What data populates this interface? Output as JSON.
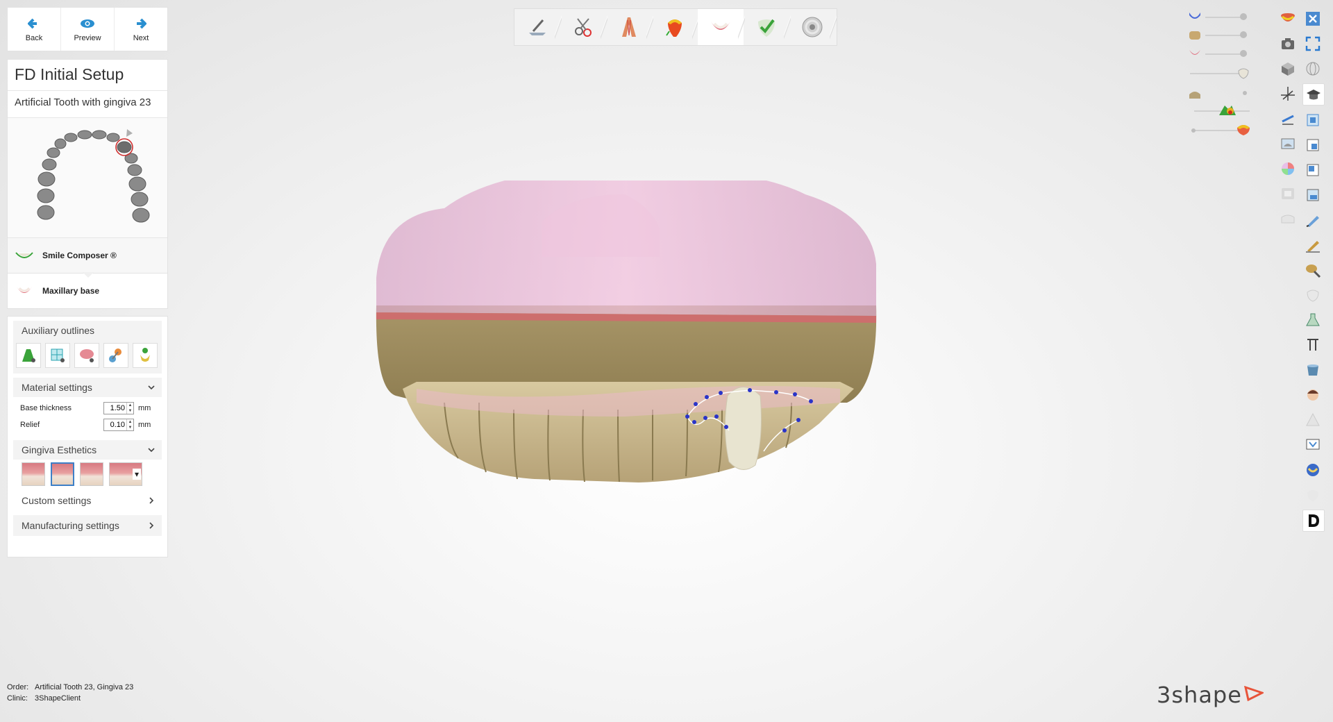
{
  "nav": {
    "back_label": "Back",
    "preview_label": "Preview",
    "next_label": "Next"
  },
  "setup": {
    "title": "FD Initial Setup",
    "subtitle": "Artificial Tooth with gingiva 23",
    "steps": [
      {
        "label": "Smile Composer ®",
        "icon": "smile-composer-icon"
      },
      {
        "label": "Maxillary base",
        "icon": "maxillary-base-icon"
      }
    ]
  },
  "panel": {
    "aux_title": "Auxiliary outlines",
    "aux_tools": [
      "gingiva-outline-icon",
      "grid-outline-icon",
      "palate-outline-icon",
      "clasp-outline-icon",
      "tooth-outline-icon"
    ],
    "material_title": "Material settings",
    "base_thickness_label": "Base thickness",
    "base_thickness_value": "1.50",
    "relief_label": "Relief",
    "relief_value": "0.10",
    "unit": "mm",
    "gingiva_title": "Gingiva Esthetics",
    "custom_settings": "Custom settings",
    "manufacturing_settings": "Manufacturing settings"
  },
  "toolbar": {
    "steps": [
      "scan-prep-icon",
      "model-tools-icon",
      "arch-icon",
      "tooth-color-icon",
      "gingiva-icon",
      "check-icon",
      "disc-icon"
    ],
    "active_index": 4
  },
  "sliders": [
    {
      "icon": "upper-jaw-icon",
      "level": 1.0
    },
    {
      "icon": "lower-jaw-icon",
      "level": 1.0
    },
    {
      "icon": "gingiva-layer-icon",
      "level": 1.0
    },
    {
      "icon": "tooth-layer-icon",
      "level": 1.0
    },
    {
      "icon": "model-layer-icon",
      "level": 1.0
    },
    {
      "icon": "distance-map-icon",
      "level": 1.0
    },
    {
      "icon": "color-layer-icon",
      "level": 1.0
    }
  ],
  "footer": {
    "order_label": "Order:",
    "order_value": "Artificial Tooth 23, Gingiva 23",
    "clinic_label": "Clinic:",
    "clinic_value": "3ShapeClient"
  },
  "brand": "3shape",
  "right_column_a": [
    "smile-colored-icon",
    "camera-icon",
    "cube-icon",
    "axis-icon",
    "measure-icon",
    "view-left-icon",
    "color-wheel-icon",
    "label-icon",
    "model-icon"
  ],
  "right_column_b": [
    "close-icon",
    "fullscreen-icon",
    "globe-icon",
    "hat-icon",
    "view-front-icon",
    "view-back-icon",
    "view-top-icon",
    "view-bottom-icon",
    "pen-icon",
    "pen-gold-icon",
    "brush-icon",
    "tooth-gray-icon",
    "flask-icon",
    "bracket-icon",
    "cup-icon",
    "face-icon",
    "triangle-icon",
    "monitor-icon",
    "teeth-blue-icon",
    "tooth-light-icon",
    "d-icon"
  ],
  "colors": {
    "accent": "#3d7fc7",
    "gingiva_pink": "#e6a8c8",
    "model_gold": "#b6a277"
  }
}
